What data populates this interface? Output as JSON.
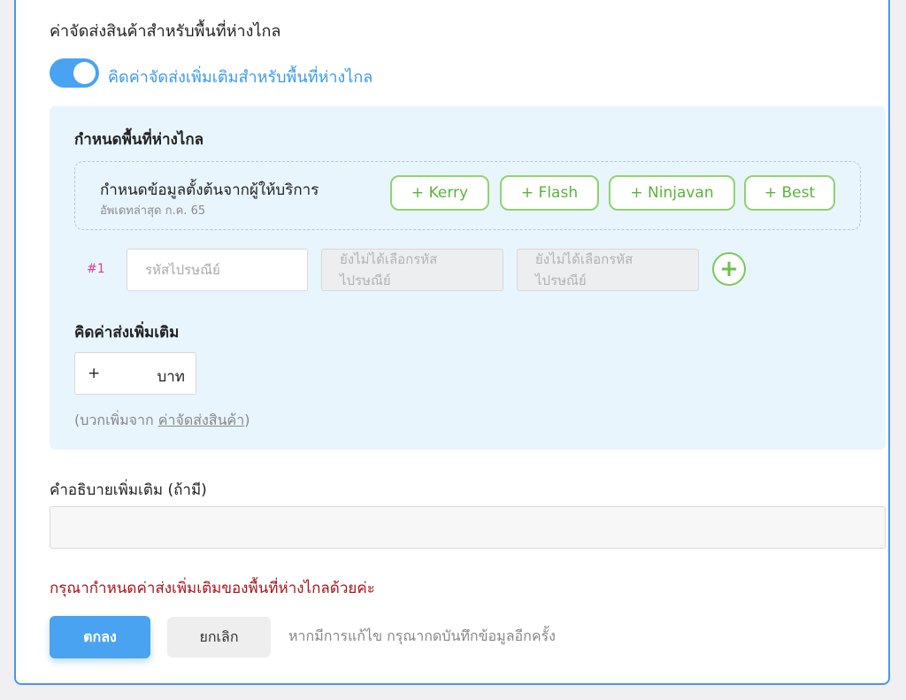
{
  "section": {
    "title": "ค่าจัดส่งสินค้าสำหรับพื้นที่ห่างไกล",
    "toggle_label": "คิดค่าจัดส่งเพิ่มเติมสำหรับพื้นที่ห่างไกล",
    "toggle_on": true
  },
  "panel": {
    "title": "กำหนดพื้นที่ห่างไกล",
    "provider": {
      "title": "กำหนดข้อมูลตั้งต้นจากผู้ให้บริการ",
      "subtitle": "อัพเดทล่าสุด ก.ค. 65",
      "buttons": [
        "+ Kerry",
        "+ Flash",
        "+ Ninjavan",
        "+ Best"
      ]
    },
    "zip_row": {
      "number": "#1",
      "zip_placeholder": "รหัสไปรษณีย์",
      "disabled_1": "ยังไม่ได้เลือกรหัสไปรษณีย์",
      "disabled_2": "ยังไม่ได้เลือกรหัสไปรษณีย์",
      "add_symbol": "+"
    },
    "extra": {
      "title": "คิดค่าส่งเพิ่มเติม",
      "prefix": "+",
      "unit": "บาท",
      "hint_prefix": "(บวกเพิ่มจาก ",
      "hint_link": "ค่าจัดส่งสินค้า",
      "hint_suffix": ")"
    }
  },
  "description": {
    "label": "คำอธิบายเพิ่มเติม (ถ้ามี)",
    "value": ""
  },
  "error": "กรุณากำหนดค่าส่งเพิ่มเติมของพื้นที่ห่างไกลด้วยค่ะ",
  "actions": {
    "ok_label": "ตกลง",
    "cancel_label": "ยกเลิก",
    "save_hint": "หากมีการแก้ไข กรุณากดบันทึกข้อมูลอีกครั้ง"
  },
  "colors": {
    "accent": "#4aa3f0",
    "provider_green": "#5bb33c",
    "error_red": "#a8151b",
    "panel_bg": "#e8f5fd"
  }
}
